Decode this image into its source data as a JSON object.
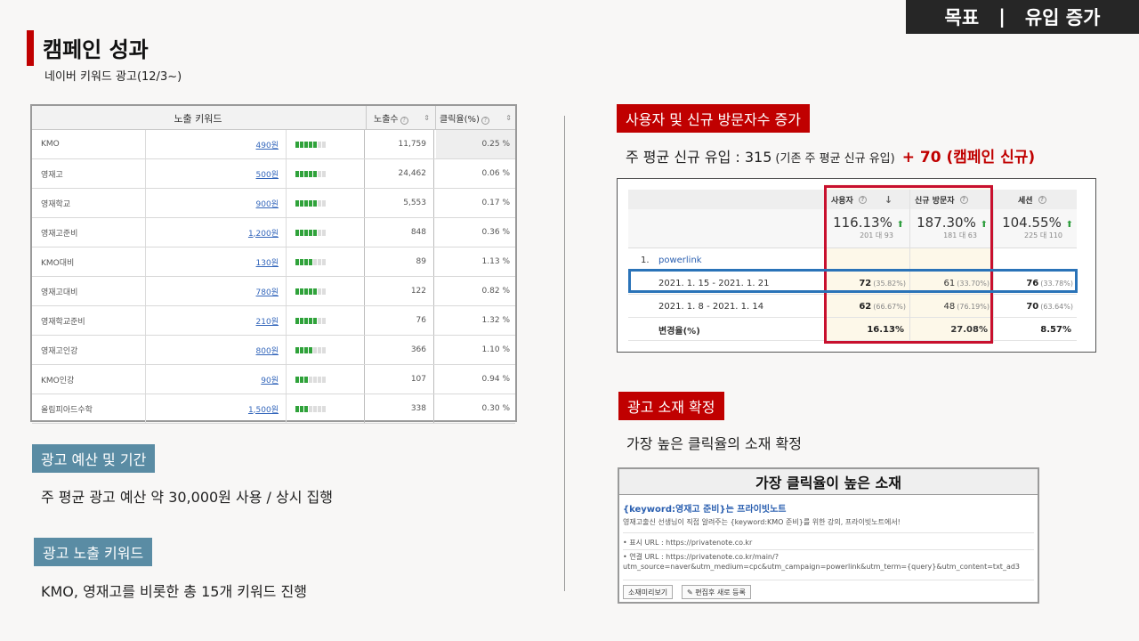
{
  "header": {
    "left": "목표",
    "sep": "|",
    "right": "유입 증가"
  },
  "title": "캠페인 성과",
  "subtitle": "네이버 키워드 광고(12/3~)",
  "keyword_table": {
    "headers": {
      "keyword": "노출 키워드",
      "impressions": "노출수",
      "ctr": "클릭율(%)",
      "help": "?",
      "sort": "⇕"
    },
    "rows": [
      {
        "name": "KMO",
        "price": "490원",
        "bars": 5,
        "impressions": "11,759",
        "ctr": "0.25 %"
      },
      {
        "name": "영재고",
        "price": "500원",
        "bars": 5,
        "impressions": "24,462",
        "ctr": "0.06 %"
      },
      {
        "name": "영재학교",
        "price": "900원",
        "bars": 5,
        "impressions": "5,553",
        "ctr": "0.17 %"
      },
      {
        "name": "영재고준비",
        "price": "1,200원",
        "bars": 5,
        "impressions": "848",
        "ctr": "0.36 %"
      },
      {
        "name": "KMO대비",
        "price": "130원",
        "bars": 4,
        "impressions": "89",
        "ctr": "1.13 %"
      },
      {
        "name": "영재고대비",
        "price": "780원",
        "bars": 5,
        "impressions": "122",
        "ctr": "0.82 %"
      },
      {
        "name": "영재학교준비",
        "price": "210원",
        "bars": 5,
        "impressions": "76",
        "ctr": "1.32 %"
      },
      {
        "name": "영재고인강",
        "price": "800원",
        "bars": 4,
        "impressions": "366",
        "ctr": "1.10 %"
      },
      {
        "name": "KMO인강",
        "price": "90원",
        "bars": 3,
        "impressions": "107",
        "ctr": "0.94 %"
      },
      {
        "name": "올림피아드수학",
        "price": "1,500원",
        "bars": 3,
        "impressions": "338",
        "ctr": "0.30 %"
      }
    ]
  },
  "budget": {
    "label": "광고 예산 및 기간",
    "text": "주 평균 광고 예산 약 30,000원 사용 / 상시 집행"
  },
  "keywords": {
    "label": "광고 노출 키워드",
    "text": "KMO, 영재고를 비롯한 총 15개 키워드 진행"
  },
  "users": {
    "label": "사용자 및 신규 방문자수 증가",
    "line_main": "주 평균 신규 유입 : 315",
    "line_small": "(기존 주 평균 신규 유입)",
    "line_plus": "+ 70 (캠페인 신규)"
  },
  "analytics": {
    "columns": {
      "users": "사용자",
      "new_visitors": "신규 방문자",
      "sessions": "세션",
      "arrow": "↓",
      "help": "?"
    },
    "summary": {
      "users": {
        "pct": "116.13%",
        "sub": "201 대 93"
      },
      "new_visitors": {
        "pct": "187.30%",
        "sub": "181 대 63"
      },
      "sessions": {
        "pct": "104.55%",
        "sub": "225 대 110"
      },
      "up": "⬆"
    },
    "group": {
      "index": "1.",
      "name": "powerlink"
    },
    "rows": [
      {
        "period": "2021. 1. 15 - 2021. 1. 21",
        "users": "72",
        "users_pct": "(35.82%)",
        "new": "61",
        "new_pct": "(33.70%)",
        "sessions": "76",
        "sessions_pct": "(33.78%)"
      },
      {
        "period": "2021. 1. 8 - 2021. 1. 14",
        "users": "62",
        "users_pct": "(66.67%)",
        "new": "48",
        "new_pct": "(76.19%)",
        "sessions": "70",
        "sessions_pct": "(63.64%)"
      },
      {
        "period": "변경율(%)",
        "users": "16.13%",
        "users_pct": "",
        "new": "27.08%",
        "new_pct": "",
        "sessions": "8.57%",
        "sessions_pct": ""
      }
    ]
  },
  "creative": {
    "label": "광고 소재 확정",
    "text": "가장 높은 클릭율의 소재 확정",
    "box_title": "가장 클릭율이 높은 소재",
    "ad_title": "{keyword:영재고 준비}는 프라이빗노트",
    "ad_desc": "영재고출신 선생님이 직접 알려주는 {keyword:KMO 준비}를 위한 강의, 프라이빗노트에서!",
    "display_url": "• 표시 URL : https://privatenote.co.kr",
    "link_url_1": "• 연결 URL : https://privatenote.co.kr/main/?",
    "link_url_2": "utm_source=naver&utm_medium=cpc&utm_campaign=powerlink&utm_term={query}&utm_content=txt_ad3",
    "btn_preview": "소재미리보기",
    "btn_edit": "✎ 편집후 새로 등록"
  }
}
